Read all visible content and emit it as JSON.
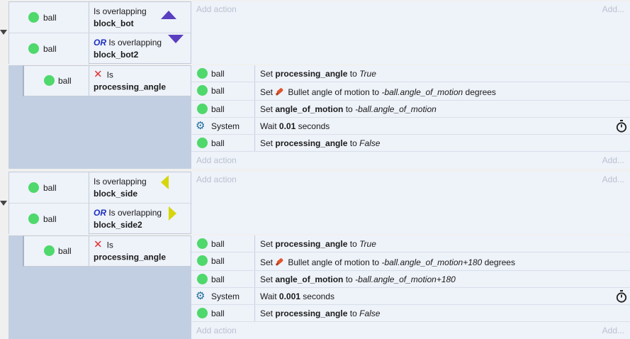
{
  "common": {
    "object": "ball",
    "system": "System",
    "add_action": "Add action",
    "add": "Add...",
    "or": "OR"
  },
  "event1": {
    "cond1": {
      "prefix": "Is overlapping",
      "target": "block_bot"
    },
    "cond2": {
      "prefix": "Is overlapping",
      "target": "block_bot2"
    },
    "sub": {
      "cond": {
        "prefix": "Is",
        "target": "processing_angle"
      },
      "actions": [
        {
          "set": "Set",
          "var": "processing_angle",
          "to": "to",
          "val": "True"
        },
        {
          "set": "Set",
          "label": "Bullet angle of motion to",
          "expr": "-ball.angle_of_motion",
          "unit": "degrees"
        },
        {
          "set": "Set",
          "var": "angle_of_motion",
          "to": "to",
          "val": "-ball.angle_of_motion"
        },
        {
          "wait": "Wait",
          "num": "0.01",
          "unit": "seconds"
        },
        {
          "set": "Set",
          "var": "processing_angle",
          "to": "to",
          "val": "False"
        }
      ]
    }
  },
  "event2": {
    "cond1": {
      "prefix": "Is overlapping",
      "target": "block_side"
    },
    "cond2": {
      "prefix": "Is overlapping",
      "target": "block_side2"
    },
    "sub": {
      "cond": {
        "prefix": "Is",
        "target": "processing_angle"
      },
      "actions": [
        {
          "set": "Set",
          "var": "processing_angle",
          "to": "to",
          "val": "True"
        },
        {
          "set": "Set",
          "label": "Bullet angle of motion to",
          "expr": "-ball.angle_of_motion+180",
          "unit": "degrees"
        },
        {
          "set": "Set",
          "var": "angle_of_motion",
          "to": "to",
          "val": "-ball.angle_of_motion+180"
        },
        {
          "wait": "Wait",
          "num": "0.001",
          "unit": "seconds"
        },
        {
          "set": "Set",
          "var": "processing_angle",
          "to": "to",
          "val": "False"
        }
      ]
    }
  },
  "colors": {
    "green_dot": "#4fd86b",
    "purple": "#5a3fc0",
    "yellow": "#d6d60a",
    "or_blue": "#1a2fbf"
  }
}
